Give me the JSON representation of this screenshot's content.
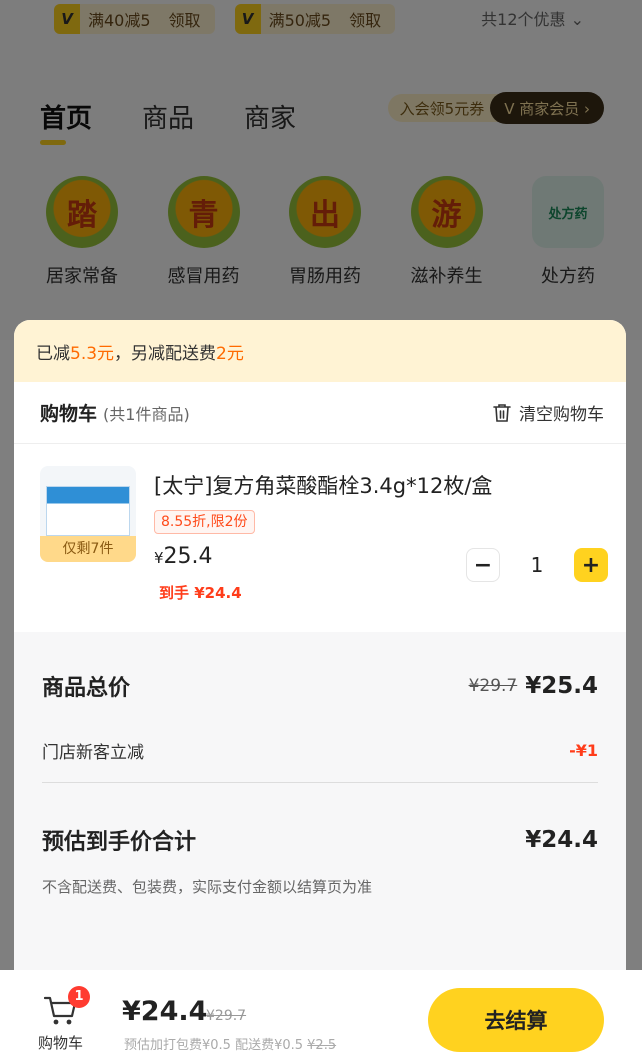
{
  "coupons": [
    {
      "badge": "V",
      "condition": "满40减5",
      "action": "领取"
    },
    {
      "badge": "V",
      "condition": "满50减5",
      "action": "领取"
    }
  ],
  "coupon_total": "共12个优惠 ⌄",
  "store_tabs": [
    "首页",
    "商品",
    "商家"
  ],
  "member": {
    "join": "入会领5元券",
    "button": "V 商家会员 ›"
  },
  "categories": [
    {
      "icon_char": "踏",
      "label": "居家常备"
    },
    {
      "icon_char": "青",
      "label": "感冒用药"
    },
    {
      "icon_char": "出",
      "label": "胃肠用药"
    },
    {
      "icon_char": "游",
      "label": "滋补养生"
    },
    {
      "icon_char": "处方药",
      "label": "处方药"
    }
  ],
  "savings": {
    "prefix": "已减",
    "amount": "5.3元",
    "middle": "，另减配送费",
    "delivery": "2元"
  },
  "cart": {
    "title": "购物车",
    "count": "(共1件商品)",
    "clear": "清空购物车",
    "item": {
      "name": "[太宁]复方角菜酸酯栓3.4g*12枚/盒",
      "stock": "仅剩7件",
      "discount": "8.55折,限2份",
      "currency": "¥",
      "price": "25.4",
      "final": "到手 ¥24.4",
      "quantity": "1",
      "minus": "−",
      "plus": "+"
    }
  },
  "summary": {
    "total_label": "商品总价",
    "total_original": "¥29.7",
    "total_value": "¥25.4",
    "newcomer_label": "门店新客立减",
    "newcomer_value": "-¥1",
    "estimate_label": "预估到手价合计",
    "estimate_value": "¥24.4",
    "note": "不含配送费、包装费，实际支付金额以结算页为准"
  },
  "bottom": {
    "badge": "1",
    "cart_label": "购物车",
    "total": "¥24.4",
    "total_original": "¥29.7",
    "fees_text": "预估加打包费¥0.5  配送费¥0.5 ",
    "fees_struck": "¥2.5",
    "checkout": "去结算"
  },
  "colors": {
    "accent": "#ffd21f",
    "discount": "#ff6a00",
    "price_red": "#ff3c1a"
  }
}
